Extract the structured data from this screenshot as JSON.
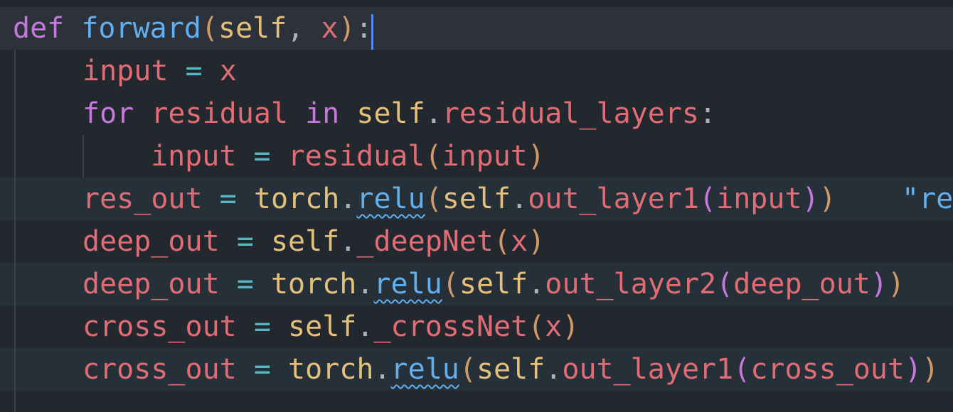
{
  "editor": {
    "lines": [
      {
        "tokens": [
          "def",
          "forward",
          "(",
          "self",
          ",",
          "x",
          ")",
          ":"
        ]
      },
      {
        "tokens": [
          "input",
          "=",
          "x"
        ]
      },
      {
        "tokens": [
          "for",
          "residual",
          "in",
          "self",
          ".",
          "residual_layers",
          ":"
        ]
      },
      {
        "tokens": [
          "input",
          "=",
          "residual",
          "(",
          "input",
          ")"
        ]
      },
      {
        "tokens": [
          "res_out",
          "=",
          "torch",
          ".",
          "relu",
          "(",
          "self",
          ".",
          "out_layer1",
          "(",
          "input",
          ")",
          ")"
        ],
        "inline_hint": "\"re"
      },
      {
        "tokens": [
          "deep_out",
          "=",
          "self",
          ".",
          "_deepNet",
          "(",
          "x",
          ")"
        ]
      },
      {
        "tokens": [
          "deep_out",
          "=",
          "torch",
          ".",
          "relu",
          "(",
          "self",
          ".",
          "out_layer2",
          "(",
          "deep_out",
          ")",
          ")"
        ]
      },
      {
        "tokens": [
          "cross_out",
          "=",
          "self",
          ".",
          "_crossNet",
          "(",
          "x",
          ")"
        ]
      },
      {
        "tokens": [
          "cross_out",
          "=",
          "torch",
          ".",
          "relu",
          "(",
          "self",
          ".",
          "out_layer1",
          "(",
          "cross_out",
          ")",
          ")"
        ]
      }
    ]
  },
  "colors": {
    "background": "#23272e",
    "keyword": "#c678dd",
    "function": "#61afef",
    "self": "#e5c07b",
    "variable": "#e06c75",
    "operator": "#56b6c2",
    "caret": "#528bff"
  }
}
